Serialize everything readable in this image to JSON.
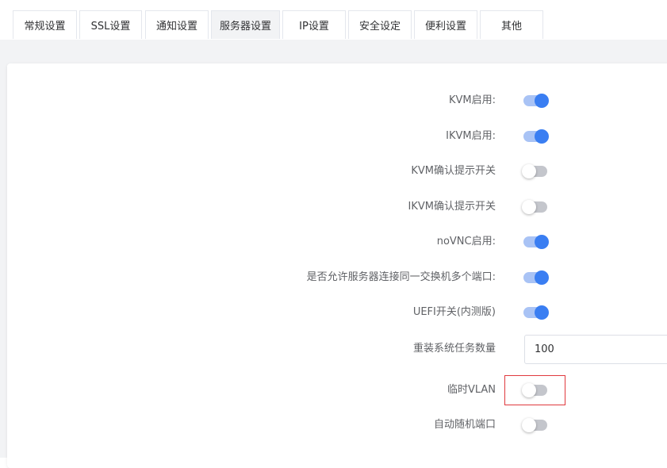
{
  "tabs": [
    {
      "label": "常规设置",
      "active": false
    },
    {
      "label": "SSL设置",
      "active": false
    },
    {
      "label": "通知设置",
      "active": false
    },
    {
      "label": "服务器设置",
      "active": true
    },
    {
      "label": "IP设置",
      "active": false
    },
    {
      "label": "安全设定",
      "active": false
    },
    {
      "label": "便利设置",
      "active": false
    },
    {
      "label": "其他",
      "active": false
    }
  ],
  "settings": {
    "kvm_enable": {
      "label": "KVM启用:",
      "on": true
    },
    "ikvm_enable": {
      "label": "IKVM启用:",
      "on": true
    },
    "kvm_confirm": {
      "label": "KVM确认提示开关",
      "on": false
    },
    "ikvm_confirm": {
      "label": "IKVM确认提示开关",
      "on": false
    },
    "novnc_enable": {
      "label": "noVNC启用:",
      "on": true
    },
    "multi_port": {
      "label": "是否允许服务器连接同一交换机多个端口:",
      "on": true
    },
    "uefi": {
      "label": "UEFI开关(内测版)",
      "on": true
    },
    "reinstall_count": {
      "label": "重装系统任务数量",
      "value": "100"
    },
    "temp_vlan": {
      "label": "临时VLAN",
      "on": false
    },
    "auto_random_port": {
      "label": "自动随机端口",
      "on": false
    }
  },
  "colors": {
    "switch_on_track": "#a9c3f5",
    "switch_on_knob": "#3a7ef2",
    "switch_off_track": "#c4c6cc",
    "highlight_border": "#e0393e"
  }
}
